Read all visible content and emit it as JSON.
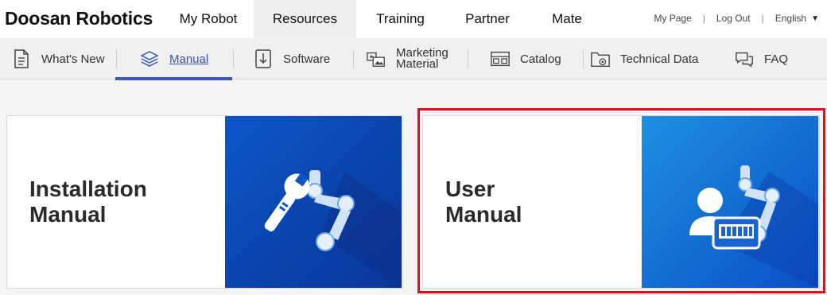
{
  "brand": "Doosan Robotics",
  "main_nav": [
    {
      "label": "My Robot",
      "active": false
    },
    {
      "label": "Resources",
      "active": true
    },
    {
      "label": "Training",
      "active": false
    },
    {
      "label": "Partner",
      "active": false
    },
    {
      "label": "Mate",
      "active": false
    }
  ],
  "util": {
    "my_page": "My Page",
    "log_out": "Log Out",
    "language": "English",
    "separator": "|"
  },
  "sub_nav": [
    {
      "label": "What's New",
      "icon": "document-icon"
    },
    {
      "label": "Manual",
      "icon": "layers-icon",
      "active": true
    },
    {
      "label": "Software",
      "icon": "download-icon"
    },
    {
      "label_line1": "Marketing",
      "label_line2": "Material",
      "icon": "media-icon"
    },
    {
      "label": "Catalog",
      "icon": "catalog-icon"
    },
    {
      "label": "Technical Data",
      "icon": "folder-gear-icon"
    },
    {
      "label": "FAQ",
      "icon": "chat-bubbles-icon"
    }
  ],
  "cards": [
    {
      "title_line1": "Installation",
      "title_line2": "Manual",
      "art": "wrench-robot-arm-icon"
    },
    {
      "title_line1": "User",
      "title_line2": "Manual",
      "art": "user-pendant-robot-arm-icon"
    }
  ],
  "colors": {
    "accent": "#3a56c9",
    "highlight": "#e0101a",
    "tile_blue_dark": "#0a3ea8",
    "tile_blue_light": "#1e8fe0"
  }
}
